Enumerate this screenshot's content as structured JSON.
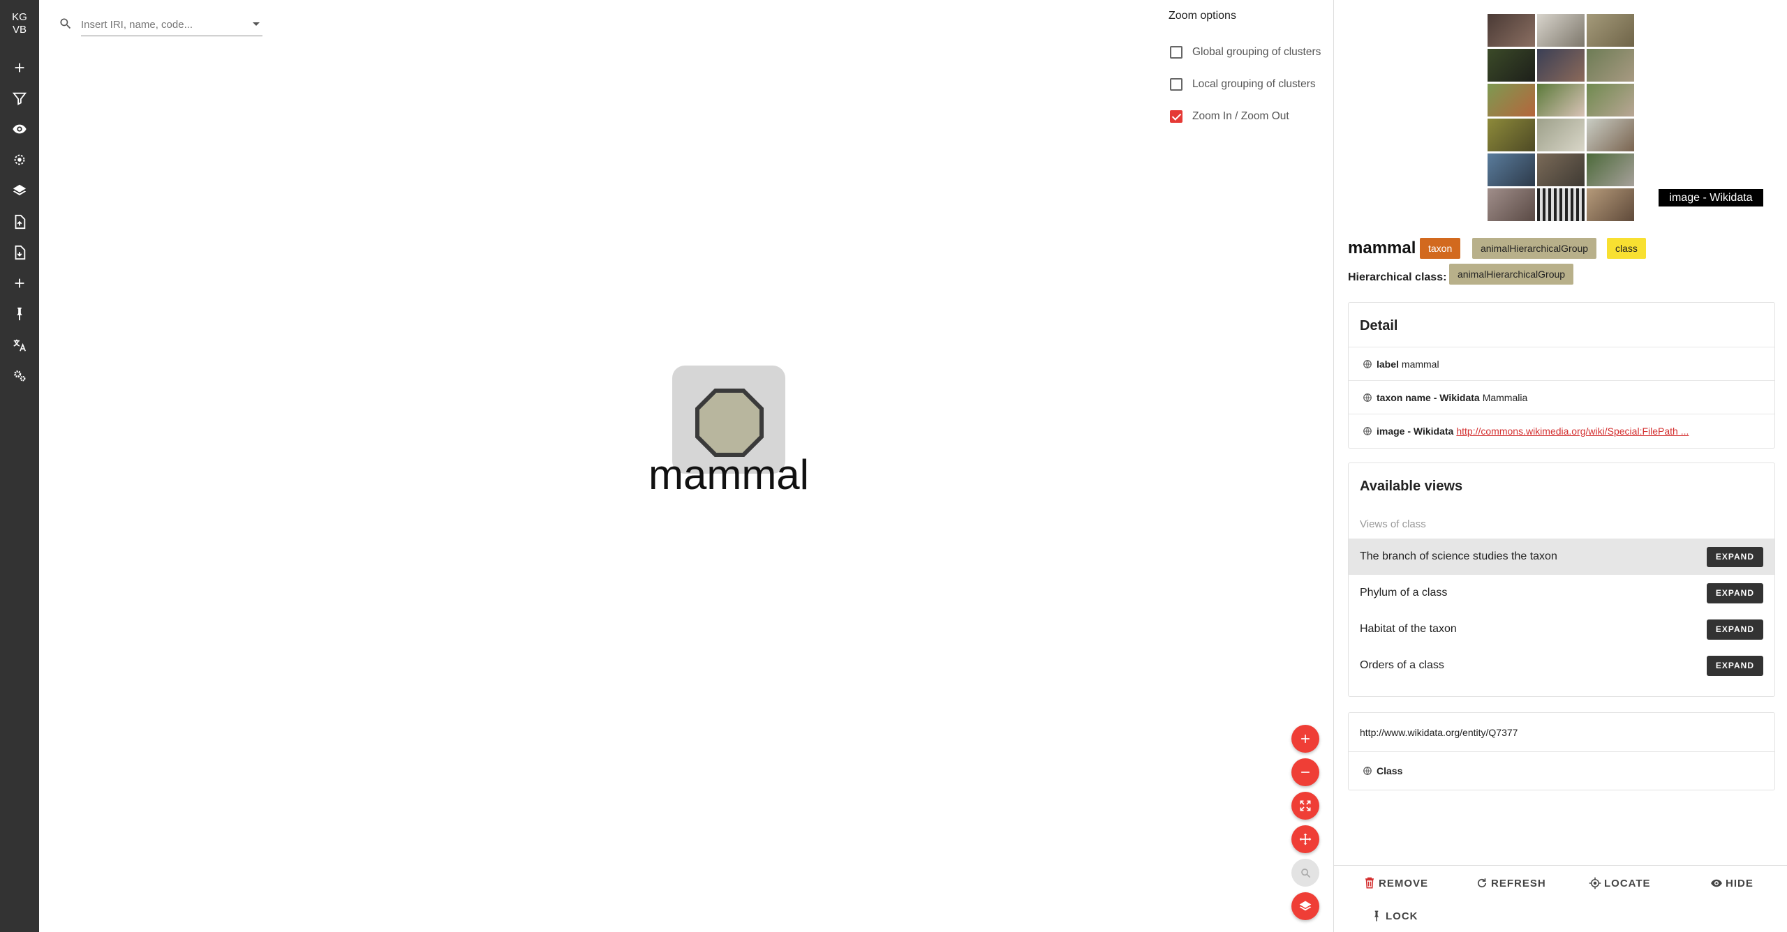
{
  "app": {
    "brand_line1": "KG",
    "brand_line2": "VB"
  },
  "sidebar": {
    "items": [
      {
        "name": "add-icon"
      },
      {
        "name": "filter-icon"
      },
      {
        "name": "eye-icon"
      },
      {
        "name": "target-icon"
      },
      {
        "name": "layers-icon"
      },
      {
        "name": "file-export-icon"
      },
      {
        "name": "file-import-icon"
      },
      {
        "name": "add-icon"
      },
      {
        "name": "pin-icon"
      },
      {
        "name": "translate-icon"
      },
      {
        "name": "settings-icon"
      }
    ]
  },
  "search": {
    "placeholder": "Insert IRI, name, code...",
    "value": ""
  },
  "zoom_options": {
    "title": "Zoom options",
    "options": [
      {
        "label": "Global grouping of clusters",
        "checked": false
      },
      {
        "label": "Local grouping of clusters",
        "checked": false
      },
      {
        "label": "Zoom In / Zoom Out",
        "checked": true
      }
    ]
  },
  "graph": {
    "node": {
      "label": "mammal",
      "fill": "#b8b69e",
      "stroke": "#3a3a3a"
    }
  },
  "fabs": [
    {
      "name": "zoom-in-icon",
      "enabled": true
    },
    {
      "name": "zoom-out-icon",
      "enabled": true
    },
    {
      "name": "fit-screen-icon",
      "enabled": true
    },
    {
      "name": "move-icon",
      "enabled": true
    },
    {
      "name": "focus-icon",
      "enabled": false
    },
    {
      "name": "layers-icon",
      "enabled": true
    }
  ],
  "panel": {
    "image_caption": "image - Wikidata",
    "title": "mammal",
    "chips": [
      "taxon",
      "animalHierarchicalGroup",
      "class"
    ],
    "hierarchical_label": "Hierarchical class:",
    "hierarchical_value": "animalHierarchicalGroup",
    "detail": {
      "title": "Detail",
      "rows": [
        {
          "key": "label",
          "value": "mammal"
        },
        {
          "key": "taxon name - Wikidata",
          "value": "Mammalia"
        },
        {
          "key": "image - Wikidata",
          "value": "http://commons.wikimedia.org/wiki/Special:FilePath ..."
        }
      ]
    },
    "views": {
      "title": "Available views",
      "subtitle": "Views of class",
      "expand_label": "EXPAND",
      "rows": [
        {
          "label": "The branch of science studies the taxon"
        },
        {
          "label": "Phylum of a class"
        },
        {
          "label": "Habitat of the taxon"
        },
        {
          "label": "Orders of a class"
        }
      ]
    },
    "uri": "http://www.wikidata.org/entity/Q7377",
    "class_label": "Class",
    "actions": {
      "remove": "REMOVE",
      "refresh": "REFRESH",
      "locate": "LOCATE",
      "hide": "HIDE",
      "lock": "LOCK"
    }
  },
  "colors": {
    "sidebar": "#333333",
    "accent": "#ef3e36",
    "chip_taxon": "#d2691e",
    "chip_group": "#b8b08a",
    "chip_class": "#f8e031"
  }
}
